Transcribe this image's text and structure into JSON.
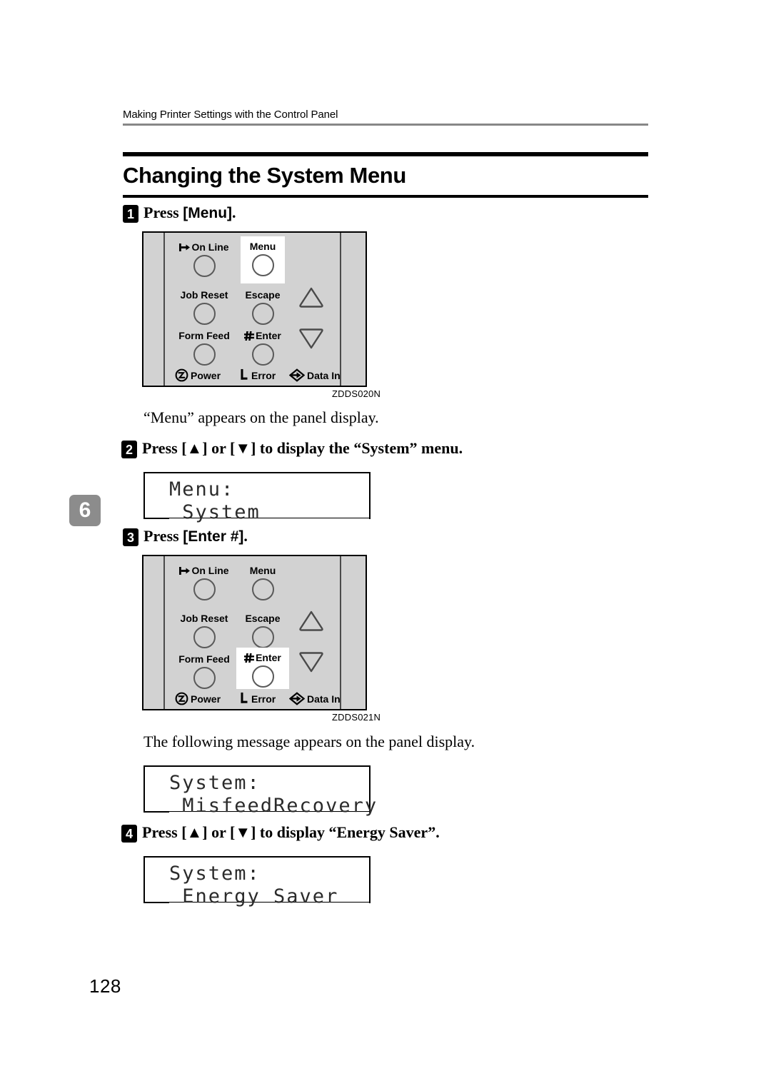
{
  "header": {
    "running_head": "Making Printer Settings with the Control Panel"
  },
  "section": {
    "title": "Changing the System Menu"
  },
  "chapter_tab": "6",
  "page_number": "128",
  "steps": [
    {
      "number": "1",
      "text_before": "Press ",
      "bracket_open": "[",
      "key": "Menu",
      "bracket_close": "]",
      "text_after": "."
    },
    {
      "number": "2",
      "full": "Press [▲] or [▼] to display the “System” menu."
    },
    {
      "number": "3",
      "text_before": "Press ",
      "bracket_open": "[",
      "key": "Enter #",
      "bracket_close": "]",
      "text_after": "."
    },
    {
      "number": "4",
      "full": "Press [▲] or [▼] to display “Energy Saver”."
    }
  ],
  "paragraphs": {
    "after_step1": "“Menu” appears on the panel display.",
    "after_step3": "The following message appears on the panel display."
  },
  "lcd_displays": [
    {
      "name": "menu-system",
      "line1": "Menu:",
      "line2": " System"
    },
    {
      "name": "system-misfeedrecovery",
      "line1": "System:",
      "line2": " MisfeedRecovery"
    },
    {
      "name": "system-energy-saver",
      "line1": "System:",
      "line2": " Energy Saver"
    }
  ],
  "control_panels": [
    {
      "caption": "ZDDS020N",
      "highlight": "Menu",
      "buttons": [
        {
          "label": "On Line",
          "icon": "online-arrow-icon"
        },
        {
          "label": "Menu",
          "icon": null
        },
        {
          "label": "Job Reset",
          "icon": null
        },
        {
          "label": "Escape",
          "icon": null
        },
        {
          "label": "Form Feed",
          "icon": null
        },
        {
          "label": "Enter",
          "icon": "hash-icon"
        }
      ],
      "arrows": [
        {
          "name": "up-arrow-button",
          "glyph": "△"
        },
        {
          "name": "down-arrow-button",
          "glyph": "▽"
        }
      ],
      "indicators": [
        {
          "label": "Power",
          "icon": "power-icon"
        },
        {
          "label": "Error",
          "icon": "error-icon"
        },
        {
          "label": "Data In",
          "icon": "data-in-icon"
        }
      ]
    },
    {
      "caption": "ZDDS021N",
      "highlight": "Enter",
      "buttons": [
        {
          "label": "On Line",
          "icon": "online-arrow-icon"
        },
        {
          "label": "Menu",
          "icon": null
        },
        {
          "label": "Job Reset",
          "icon": null
        },
        {
          "label": "Escape",
          "icon": null
        },
        {
          "label": "Form Feed",
          "icon": null
        },
        {
          "label": "Enter",
          "icon": "hash-icon"
        }
      ],
      "arrows": [
        {
          "name": "up-arrow-button",
          "glyph": "△"
        },
        {
          "name": "down-arrow-button",
          "glyph": "▽"
        }
      ],
      "indicators": [
        {
          "label": "Power",
          "icon": "power-icon"
        },
        {
          "label": "Error",
          "icon": "error-icon"
        },
        {
          "label": "Data In",
          "icon": "data-in-icon"
        }
      ]
    }
  ],
  "colors": {
    "panel_face": "#d2d2d2",
    "chapter_tab": "#8c8c8c",
    "rule": "#000000",
    "header_rule": "#878787"
  }
}
